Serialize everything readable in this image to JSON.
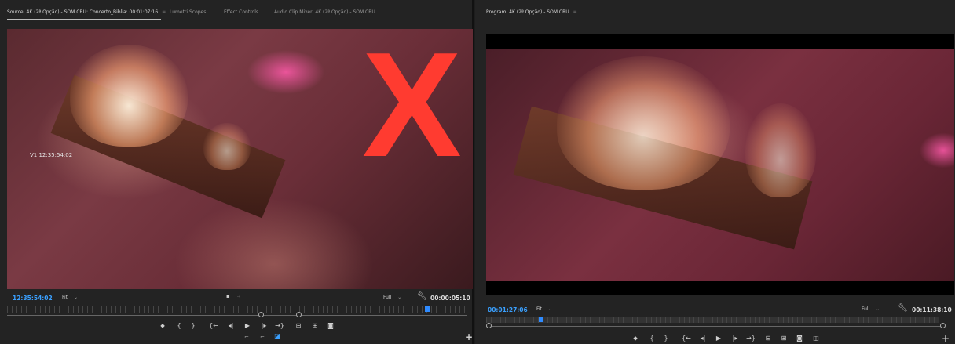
{
  "source": {
    "tabs": [
      {
        "label": "Source: 4K (2ª Opção) - SOM CRU: Concerto_Biblia: 00:01:07:16"
      },
      {
        "label": "Lumetri Scopes"
      },
      {
        "label": "Effect Controls"
      },
      {
        "label": "Audio Clip Mixer: 4K (2ª Opção) - SOM CRU"
      }
    ],
    "menu_glyph": "≡",
    "overlay_timecode": "V1 12:35:54:02",
    "overlay_mark": "X",
    "timecode": "12:35:54:02",
    "fit_label": "Fit",
    "quality_label": "Full",
    "duration": "00:00:05:10"
  },
  "program": {
    "tab": "Program: 4K (2ª Opção) - SOM CRU",
    "menu_glyph": "≡",
    "timecode": "00:01:27:06",
    "fit_label": "Fit",
    "quality_label": "Full",
    "duration": "00:11:38:10"
  },
  "transport": {
    "add_marker": "⬥",
    "mark_in": "{",
    "mark_out": "}",
    "go_to_in": "{←",
    "step_back": "◂|",
    "play": "▶",
    "step_forward": "|▸",
    "go_to_out": "→}",
    "insert": "⊟",
    "overwrite": "⊞",
    "export_frame": "◙"
  },
  "colors": {
    "timecode": "#3aa0ff",
    "mark": "#ff3b30",
    "panel_bg": "#232323"
  }
}
